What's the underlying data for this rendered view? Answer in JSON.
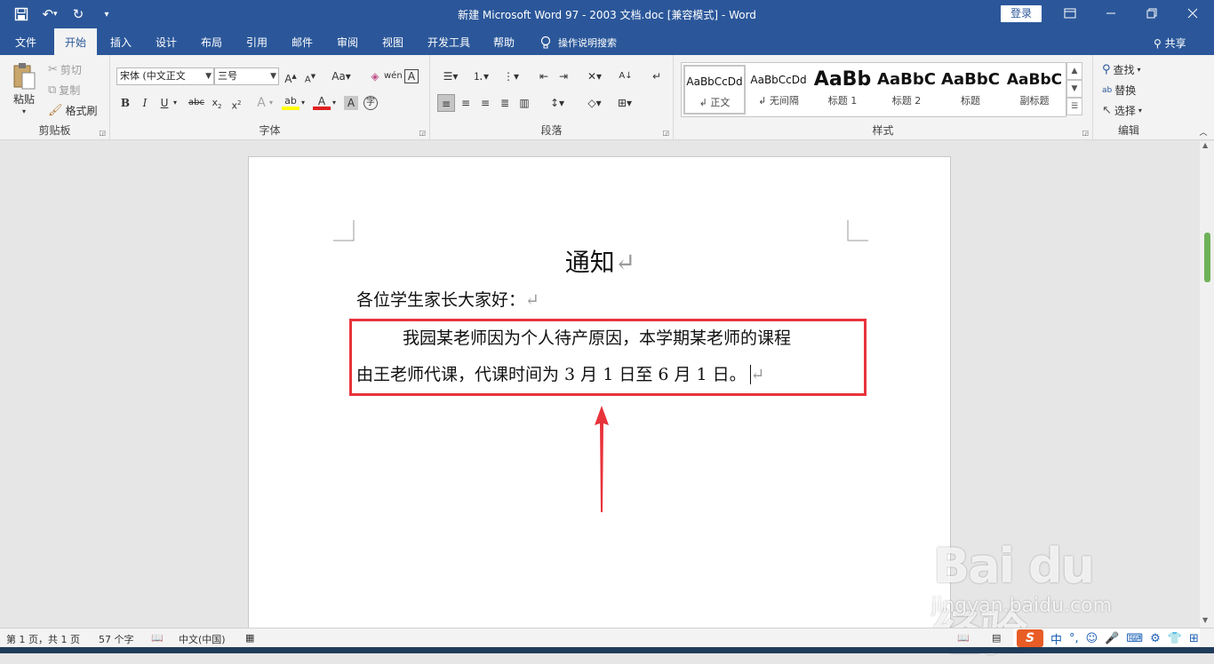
{
  "titlebar": {
    "title": "新建 Microsoft Word 97 - 2003 文档.doc [兼容模式]  -  Word",
    "login": "登录"
  },
  "tabs": [
    "文件",
    "开始",
    "插入",
    "设计",
    "布局",
    "引用",
    "邮件",
    "审阅",
    "视图",
    "开发工具",
    "帮助"
  ],
  "active_tab": "开始",
  "tell_me": "操作说明搜索",
  "share": "共享",
  "clipboard": {
    "paste": "粘贴",
    "cut": "剪切",
    "copy": "复制",
    "format_painter": "格式刷",
    "label": "剪贴板"
  },
  "font": {
    "name": "宋体 (中文正文",
    "size": "三号",
    "label": "字体",
    "case": "Aa"
  },
  "paragraph": {
    "label": "段落"
  },
  "styles": {
    "label": "样式",
    "items": [
      {
        "sample": "AaBbCcDd",
        "name": "↲ 正文"
      },
      {
        "sample": "AaBbCcDd",
        "name": "↲ 无间隔"
      },
      {
        "sample": "AaBb",
        "name": "标题 1"
      },
      {
        "sample": "AaBbC",
        "name": "标题 2"
      },
      {
        "sample": "AaBbC",
        "name": "标题"
      },
      {
        "sample": "AaBbC",
        "name": "副标题"
      }
    ]
  },
  "editing": {
    "find": "查找",
    "replace": "替换",
    "select": "选择",
    "label": "编辑"
  },
  "document": {
    "heading": "通知",
    "greeting": "各位学生家长大家好：",
    "line1": "我园某老师因为个人待产原因，本学期某老师的课程",
    "line2": "由王老师代课，代课时间为 3 月 1 日至 6 月 1 日。",
    "para_mark": "↵"
  },
  "status": {
    "page": "第 1 页，共 1 页",
    "words": "57 个字",
    "language": "中文(中国)"
  },
  "ime": {
    "mode": "中"
  },
  "watermark": {
    "logo": "Bai du 经验",
    "url": "jingyan.baidu.com"
  },
  "colors": {
    "accent": "#2b579a",
    "highlight": "#e8333b"
  }
}
